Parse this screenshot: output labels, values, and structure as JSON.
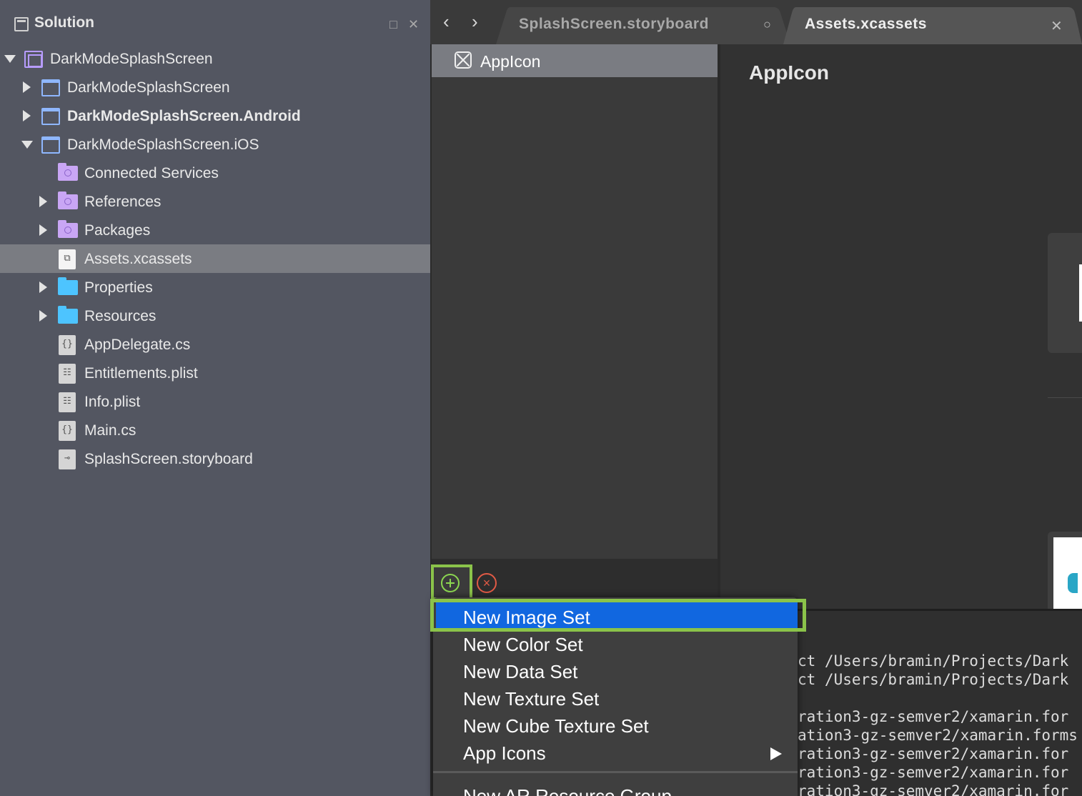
{
  "solution_pad": {
    "title": "Solution",
    "buttons": {
      "maximize": "□",
      "close": "✕"
    },
    "tree": [
      {
        "label": "DarkModeSplashScreen",
        "type": "solution",
        "expanded": true,
        "bold": false
      },
      {
        "label": "DarkModeSplashScreen",
        "type": "project",
        "expanded": false,
        "bold": false
      },
      {
        "label": "DarkModeSplashScreen.Android",
        "type": "project",
        "expanded": false,
        "bold": true
      },
      {
        "label": "DarkModeSplashScreen.iOS",
        "type": "project",
        "expanded": true,
        "bold": false
      },
      {
        "label": "Connected Services",
        "type": "folder-purple",
        "bold": false
      },
      {
        "label": "References",
        "type": "folder-purple",
        "expanded": false,
        "bold": false
      },
      {
        "label": "Packages",
        "type": "folder-purple",
        "expanded": false,
        "bold": false
      },
      {
        "label": "Assets.xcassets",
        "type": "asset-file",
        "selected": true,
        "bold": false
      },
      {
        "label": "Properties",
        "type": "folder-blue",
        "expanded": false,
        "bold": false
      },
      {
        "label": "Resources",
        "type": "folder-blue",
        "expanded": false,
        "bold": false
      },
      {
        "label": "AppDelegate.cs",
        "type": "cs-file",
        "bold": false
      },
      {
        "label": "Entitlements.plist",
        "type": "plist-file",
        "bold": false
      },
      {
        "label": "Info.plist",
        "type": "plist-file",
        "bold": false
      },
      {
        "label": "Main.cs",
        "type": "cs-file",
        "bold": false
      },
      {
        "label": "SplashScreen.storyboard",
        "type": "storyboard-file",
        "bold": false
      }
    ]
  },
  "tabbar": {
    "back": "‹",
    "forward": "›",
    "tabs": [
      {
        "label": "SplashScreen.storyboard",
        "active": false,
        "close": "○"
      },
      {
        "label": "Assets.xcassets",
        "active": true,
        "close": "✕"
      }
    ]
  },
  "asset_list": {
    "items": [
      {
        "label": "AppIcon",
        "selected": true,
        "icon": "appicon-icon"
      }
    ]
  },
  "editor": {
    "title": "AppIcon"
  },
  "toolbar": {
    "remove_glyph": "×"
  },
  "context_menu": {
    "items": [
      {
        "label": "New Image Set",
        "highlighted": true
      },
      {
        "label": "New Color Set"
      },
      {
        "label": "New Data Set"
      },
      {
        "label": "New Texture Set"
      },
      {
        "label": "New Cube Texture Set"
      },
      {
        "label": "App Icons",
        "submenu": true
      },
      {
        "label": "New AR Resource Group"
      }
    ]
  },
  "output": {
    "lines": [
      "ct /Users/bramin/Projects/Dark",
      "ct /Users/bramin/Projects/Dark",
      "",
      "ration3-gz-semver2/xamarin.for",
      "ation3-gz-semver2/xamarin.forms",
      "ration3-gz-semver2/xamarin.for",
      "ration3-gz-semver2/xamarin.for",
      "ration3-gz-semver2/xamarin.for"
    ]
  },
  "colors": {
    "sidebar_bg": "#535661",
    "selection": "#7a7c82",
    "menu_highlight": "#1167e0",
    "annotation_green": "#8bc34a",
    "add_green": "#8bd650",
    "remove_red": "#e05a45"
  }
}
